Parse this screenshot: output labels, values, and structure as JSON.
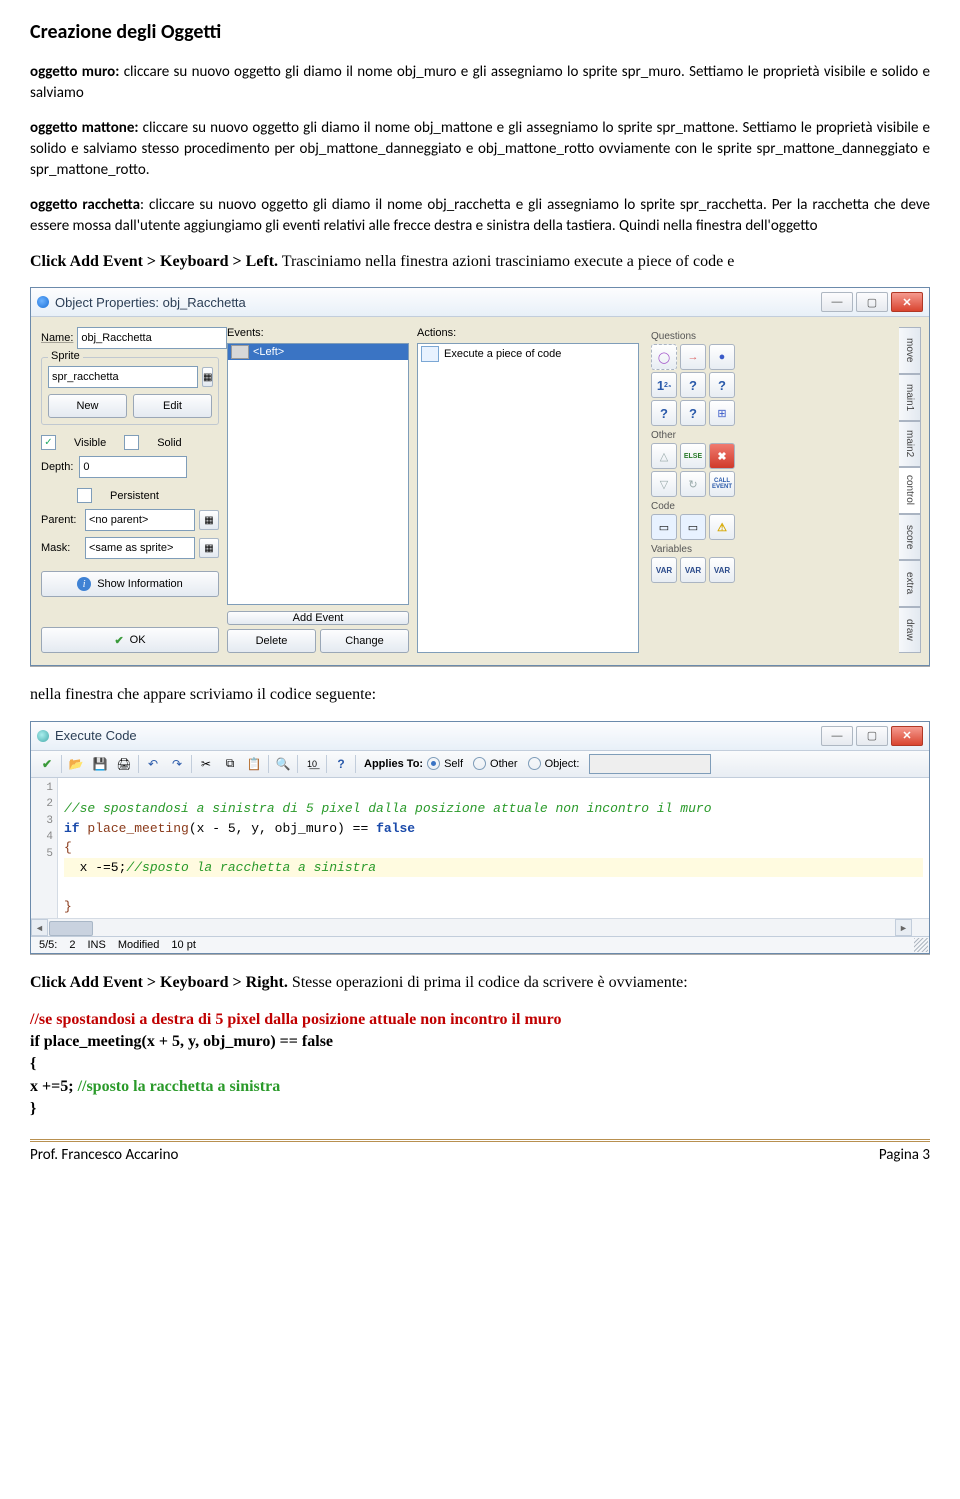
{
  "heading": "Creazione degli Oggetti",
  "para1": "oggetto muro: cliccare su nuovo oggetto gli diamo il nome obj_muro e gli assegniamo lo sprite spr_muro. Settiamo le proprietà visibile e solido e salviamo",
  "para2": "oggetto mattone: cliccare su nuovo oggetto gli diamo il nome obj_mattone e gli assegniamo lo sprite spr_mattone. Settiamo le proprietà visibile e solido e salviamo stesso procedimento per obj_mattone_danneggiato e obj_mattone_rotto ovviamente con le sprite spr_mattone_danneggiato e spr_mattone_rotto.",
  "para3": "oggetto racchetta: cliccare su nuovo oggetto gli diamo il nome obj_racchetta e gli assegniamo lo sprite spr_racchetta. Per la racchetta che deve essere mossa dall'utente aggiungiamo gli eventi relativi alle frecce destra e sinistra della tastiera. Quindi nella finestra dell'oggetto",
  "para4_bold": "Click Add Event > Keyboard > Left.",
  "para4_rest": " Trasciniamo nella finestra azioni trasciniamo execute a piece of code e",
  "obj_dlg": {
    "title": "Object Properties: obj_Racchetta",
    "name_lbl": "Name:",
    "name_val": "obj_Racchetta",
    "sprite_grp": "Sprite",
    "sprite_val": "spr_racchetta",
    "new_btn": "New",
    "edit_btn": "Edit",
    "visible_lbl": "Visible",
    "solid_lbl": "Solid",
    "depth_lbl": "Depth:",
    "depth_val": "0",
    "persistent_lbl": "Persistent",
    "parent_lbl": "Parent:",
    "parent_val": "<no parent>",
    "mask_lbl": "Mask:",
    "mask_val": "<same as sprite>",
    "showinfo_btn": "Show Information",
    "ok_btn": "OK",
    "events_hdr": "Events:",
    "event_item": "<Left>",
    "addevent_btn": "Add Event",
    "delete_btn": "Delete",
    "change_btn": "Change",
    "actions_hdr": "Actions:",
    "action_item": "Execute a piece of code",
    "grp_questions": "Questions",
    "grp_other": "Other",
    "grp_code": "Code",
    "grp_variables": "Variables",
    "else": "ELSE",
    "call": "CALL\nEVENT",
    "var": "VAR",
    "vtabs": [
      "move",
      "main1",
      "main2",
      "control",
      "score",
      "extra",
      "draw"
    ]
  },
  "mid_text": "nella finestra che appare scriviamo il codice seguente:",
  "code_dlg": {
    "title": "Execute Code",
    "applies": "Applies To:",
    "self": "Self",
    "other": "Other",
    "object": "Object:",
    "lines": {
      "l1": "//se spostandosi a sinistra di 5 pixel dalla posizione attuale non incontro il muro",
      "l2a": "if",
      "l2b": " place_meeting",
      "l2c": "(x - 5, y, obj_muro) == ",
      "l2d": "false",
      "l3": "{",
      "l4a": "  x -=5;",
      "l4b": "//sposto la racchetta a sinistra",
      "l5": "}"
    },
    "status": {
      "pos": "5/5:",
      "col": "2",
      "ins": "INS",
      "mod": "Modified",
      "pt": "10 pt"
    }
  },
  "para5_bold": "Click Add Event > Keyboard > Right.",
  "para5_rest": " Stesse operazioni di prima il codice da scrivere è ovviamente:",
  "bottom_code": {
    "l1": "//se spostandosi a destra di 5 pixel dalla posizione attuale non incontro il muro",
    "l2": "if place_meeting(x + 5, y, obj_muro) == false",
    "l3": "{",
    "l4a": "  x +=5; ",
    "l4b": "//sposto la racchetta a sinistra",
    "l5": "}"
  },
  "footer": {
    "left": "Prof. Francesco Accarino",
    "right": "Pagina 3"
  }
}
